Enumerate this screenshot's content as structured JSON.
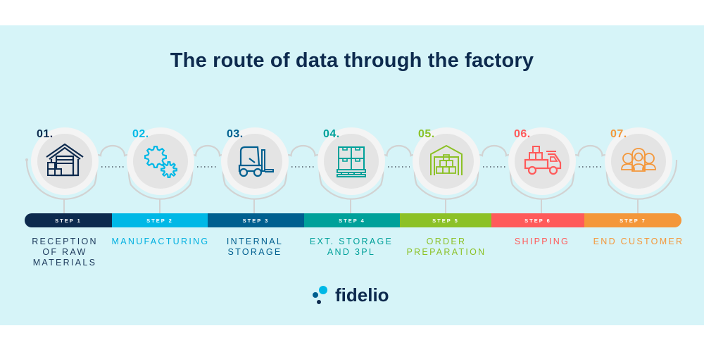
{
  "title": "The route of data through the factory",
  "colors": {
    "background_band": "#d6f4f8",
    "title": "#0d2a4e",
    "wave": "#d2d2d2",
    "circle_outer": "#f4f4f4",
    "circle_inner": "#e4e4e4",
    "dots": "#4a5560"
  },
  "steps": [
    {
      "number": "01.",
      "bar_label": "STEP 1",
      "label": "RECEPTION\nOF RAW\nMATERIALS",
      "icon": "warehouse-icon",
      "color": "#0d2a4e",
      "label_color": "#1d3a5c"
    },
    {
      "number": "02.",
      "bar_label": "STEP 2",
      "label": "MANUFACTURING",
      "icon": "gears-icon",
      "color": "#00b8e6",
      "label_color": "#00b0e0"
    },
    {
      "number": "03.",
      "bar_label": "STEP 3",
      "label": "INTERNAL\nSTORAGE",
      "icon": "forklift-icon",
      "color": "#005f8f",
      "label_color": "#005f8f"
    },
    {
      "number": "04.",
      "bar_label": "STEP 4",
      "label": "EXT. STORAGE\nAND 3PL",
      "icon": "pallet-boxes-icon",
      "color": "#00a19a",
      "label_color": "#00a19a"
    },
    {
      "number": "05.",
      "bar_label": "STEP 5",
      "label": "ORDER\nPREPARATION",
      "icon": "warehouse-boxes-icon",
      "color": "#8cc126",
      "label_color": "#8cc126"
    },
    {
      "number": "06.",
      "bar_label": "STEP 6",
      "label": "SHIPPING",
      "icon": "truck-icon",
      "color": "#ff5a5a",
      "label_color": "#ff5a5a"
    },
    {
      "number": "07.",
      "bar_label": "STEP 7",
      "label": "END CUSTOMER",
      "icon": "customers-icon",
      "color": "#f4973a",
      "label_color": "#f4973a"
    }
  ],
  "logo": {
    "text": "fidelio",
    "icon": "fidelio-dots-logo-icon"
  }
}
